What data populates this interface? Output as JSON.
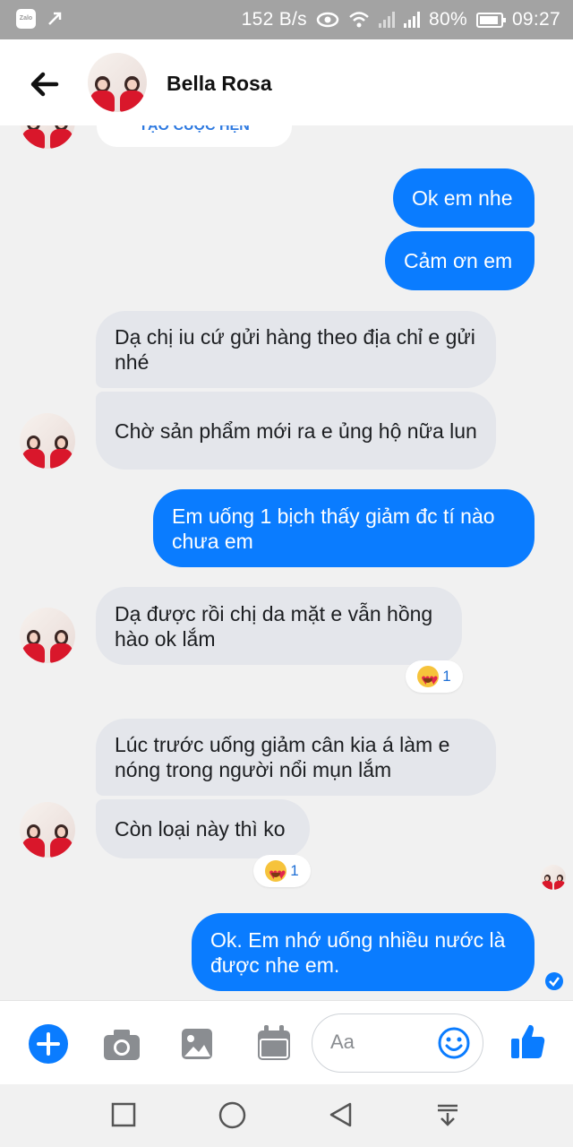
{
  "status_bar": {
    "app_icon": "Zalo",
    "speed": "152 B/s",
    "battery": "80%",
    "time": "09:27"
  },
  "header": {
    "contact_name": "Bella Rosa",
    "back_icon": "arrow-left-icon"
  },
  "partial_banner": "TẠO CUỘC HẸN",
  "messages": [
    {
      "dir": "out",
      "text": "Ok em nhe"
    },
    {
      "dir": "out",
      "text": "Cảm ơn em"
    },
    {
      "dir": "in",
      "text": "Dạ chị iu cứ gửi hàng theo địa chỉ e gửi nhé"
    },
    {
      "dir": "in",
      "text": "Chờ sản phẩm mới ra e ủng hộ nữa lun"
    },
    {
      "dir": "out",
      "text": "Em uống 1 bịch thấy giảm đc tí nào chưa em"
    },
    {
      "dir": "in",
      "text": "Dạ được rồi chị da mặt e vẫn hồng hào ok lắm"
    },
    {
      "dir": "in",
      "text": "Lúc trước uống giảm cân kia á làm e nóng trong người nổi mụn lắm"
    },
    {
      "dir": "in",
      "text": "Còn loại này thì ko"
    },
    {
      "dir": "out",
      "text": "Ok.  Em nhớ uống nhiều nước là được nhe em."
    }
  ],
  "reactions": [
    {
      "emoji": "heart-eyes",
      "count": "1"
    },
    {
      "emoji": "heart-eyes",
      "count": "1"
    }
  ],
  "composer": {
    "placeholder": "Aa",
    "icons": [
      "plus-icon",
      "camera-icon",
      "image-icon",
      "calendar-icon",
      "emoji-icon",
      "thumbs-up-icon"
    ]
  },
  "colors": {
    "accent": "#0a7cff",
    "incoming_bubble": "#e4e6eb",
    "background": "#f1f1f1",
    "status_bar": "#a3a3a3"
  }
}
